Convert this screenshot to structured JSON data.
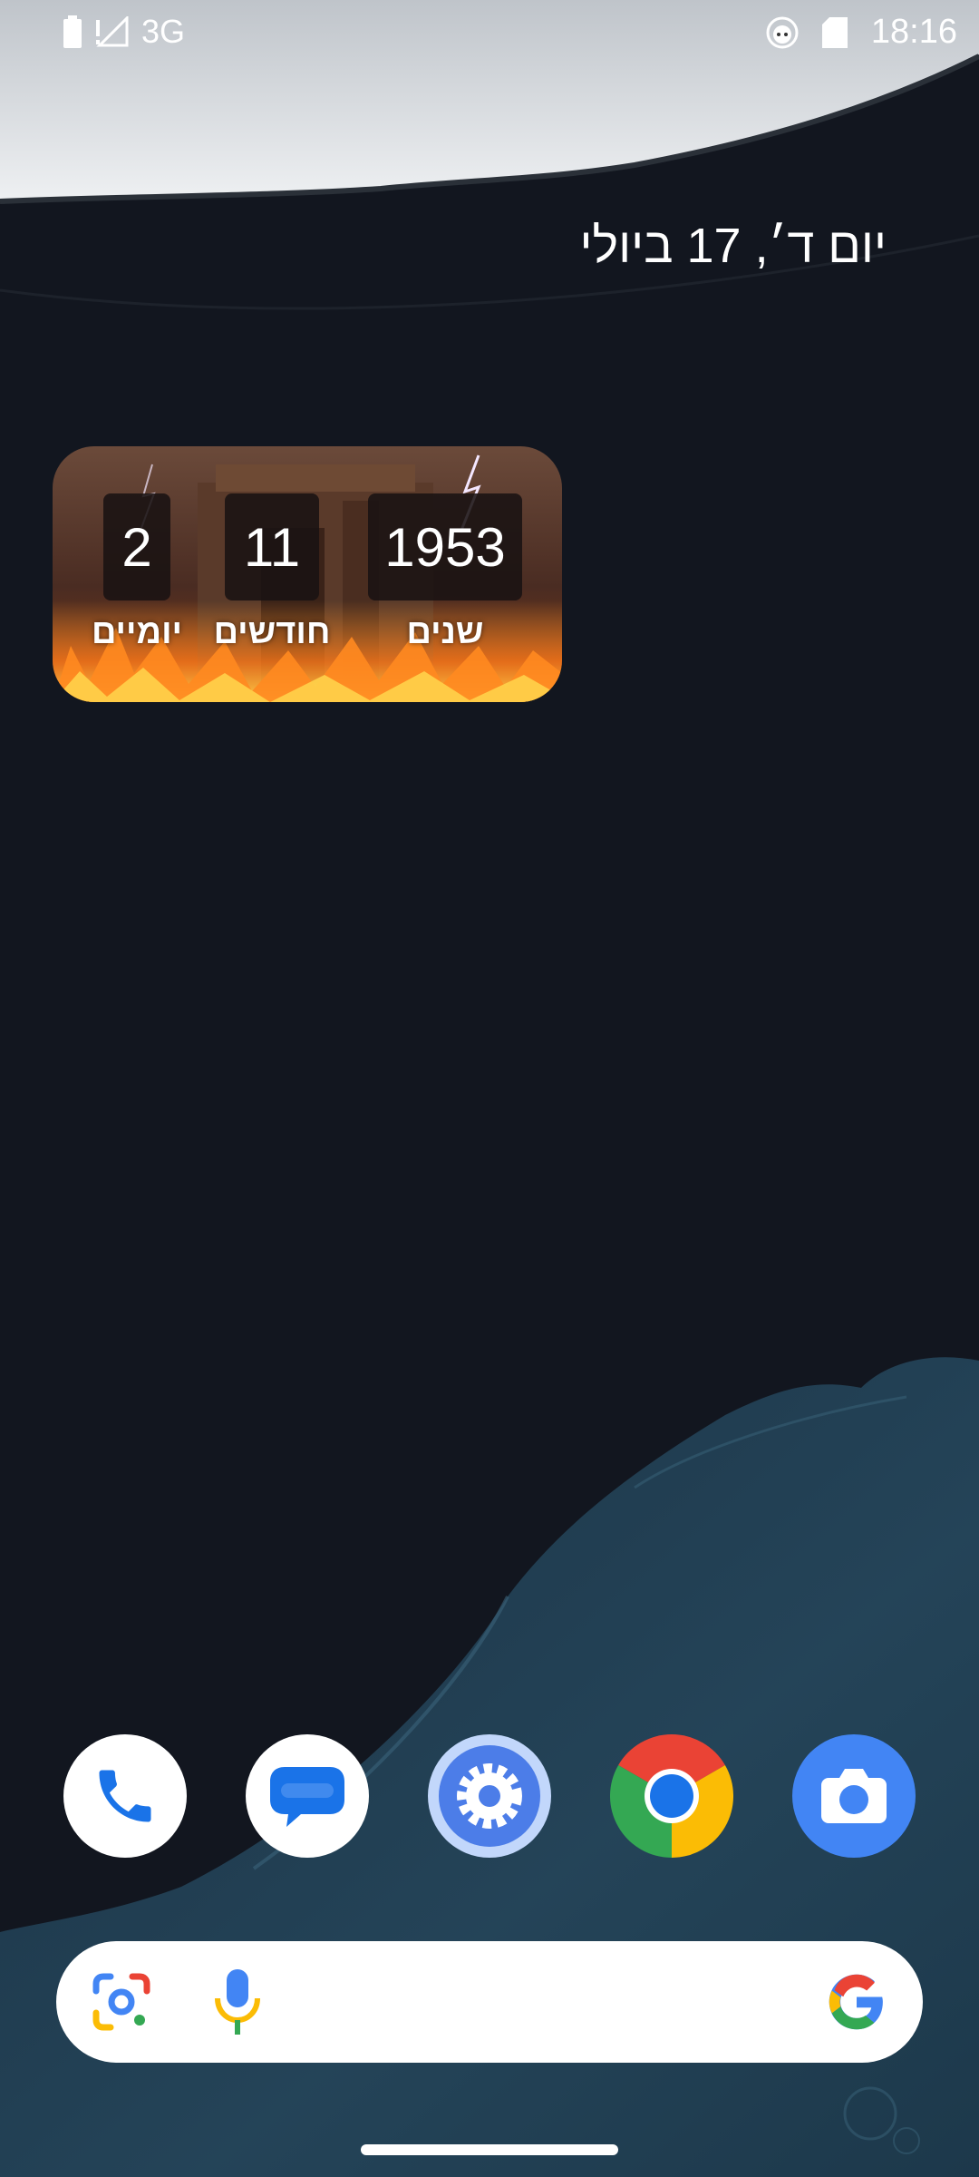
{
  "status_bar": {
    "network": "3G",
    "time": "18:16",
    "icons": [
      "battery-icon",
      "no-signal-icon",
      "notification-app-icon",
      "sd-card-icon"
    ]
  },
  "date_widget": {
    "text": "יום ד׳, 17 ביולי"
  },
  "countdown_widget": {
    "years_value": "1953",
    "years_label": "שנים",
    "months_value": "11",
    "months_label": "חודשים",
    "days_value": "2",
    "days_label": "יומיים"
  },
  "dock": {
    "apps": [
      "phone-app-icon",
      "messages-app-icon",
      "settings-app-icon",
      "chrome-app-icon",
      "camera-app-icon"
    ]
  },
  "search_bar": {
    "icons": [
      "google-lens-icon",
      "microphone-icon",
      "google-logo-icon"
    ]
  },
  "colors": {
    "background": "#12161f",
    "water": "#234459",
    "sky": "#d9dde2",
    "google_blue": "#4285f4",
    "google_red": "#ea4335",
    "google_yellow": "#fbbc05",
    "google_green": "#34a853"
  }
}
